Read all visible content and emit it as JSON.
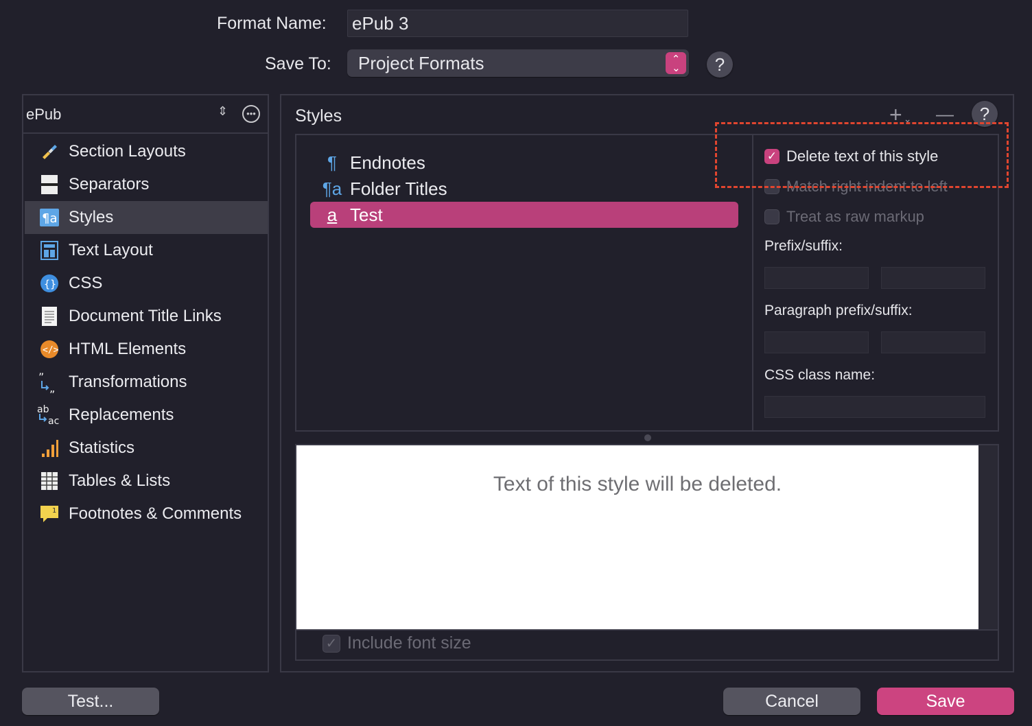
{
  "header": {
    "format_name_label": "Format Name:",
    "format_name_value": "ePub 3",
    "save_to_label": "Save To:",
    "save_to_value": "Project Formats",
    "help": "?"
  },
  "sidebar": {
    "format_selector": "ePub",
    "items": [
      {
        "label": "Section Layouts",
        "icon": "brush-icon"
      },
      {
        "label": "Separators",
        "icon": "separator-icon"
      },
      {
        "label": "Styles",
        "icon": "styles-icon",
        "selected": true
      },
      {
        "label": "Text Layout",
        "icon": "text-layout-icon"
      },
      {
        "label": "CSS",
        "icon": "css-icon"
      },
      {
        "label": "Document Title Links",
        "icon": "document-icon"
      },
      {
        "label": "HTML Elements",
        "icon": "html-icon"
      },
      {
        "label": "Transformations",
        "icon": "transform-icon"
      },
      {
        "label": "Replacements",
        "icon": "replace-icon"
      },
      {
        "label": "Statistics",
        "icon": "bar-chart-icon"
      },
      {
        "label": "Tables & Lists",
        "icon": "table-icon"
      },
      {
        "label": "Footnotes & Comments",
        "icon": "comment-icon"
      }
    ]
  },
  "styles_panel": {
    "title": "Styles",
    "add": "+",
    "remove": "—",
    "help": "?",
    "styles": [
      {
        "label": "Endnotes",
        "glyph": "¶"
      },
      {
        "label": "Folder Titles",
        "glyph": "¶a"
      },
      {
        "label": "Test",
        "glyph": "a",
        "selected": true
      }
    ],
    "options": {
      "delete_text": {
        "label": "Delete text of this style",
        "checked": true
      },
      "match_indent": {
        "label": "Match right indent to left",
        "checked": false
      },
      "raw_markup": {
        "label": "Treat as raw markup",
        "checked": false
      },
      "prefix_suffix_label": "Prefix/suffix:",
      "paragraph_prefix_suffix_label": "Paragraph prefix/suffix:",
      "css_class_label": "CSS class name:"
    },
    "preview_text": "Text of this style will be deleted.",
    "include_font_size": {
      "label": "Include font size",
      "checked": true
    }
  },
  "footer": {
    "test_button": "Test...",
    "cancel_button": "Cancel",
    "save_button": "Save"
  },
  "colors": {
    "background": "#21202b",
    "accent": "#c9427e",
    "selection": "#b9407a",
    "annotation": "#e0452f"
  }
}
